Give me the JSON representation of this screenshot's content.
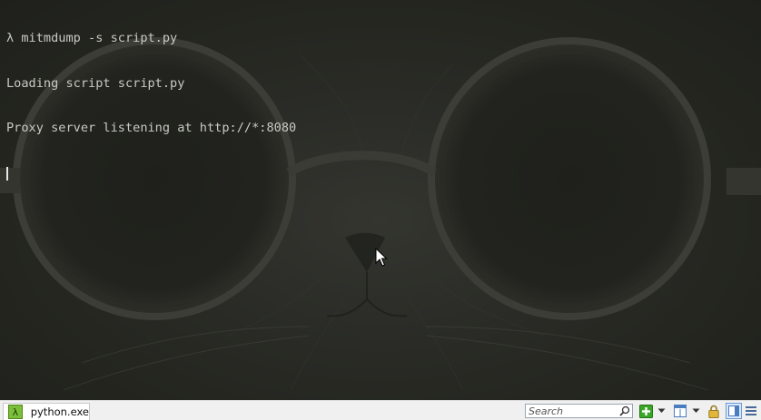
{
  "terminal": {
    "lines": [
      "λ mitmdump -s script.py",
      "Loading script script.py",
      "Proxy server listening at http://*:8080"
    ]
  },
  "tabbar": {
    "tabs": [
      {
        "label": "python.exe",
        "icon": "lambda-icon"
      }
    ],
    "search": {
      "placeholder": "Search",
      "value": ""
    },
    "buttons": {
      "new_console": "plus-icon",
      "new_console_dropdown": "chevron-down-icon",
      "layout": "layout-icon",
      "layout_dropdown": "chevron-down-icon",
      "lock": "lock-icon",
      "panel_toggle": "panel-icon",
      "menu": "hamburger-menu-icon"
    }
  },
  "colors": {
    "terminal_text": "#c9c9c4",
    "terminal_bg": "#2b2c27",
    "tabbar_bg": "#f0f0f0",
    "accent_green": "#3aa628",
    "accent_blue": "#4a7cc0"
  }
}
